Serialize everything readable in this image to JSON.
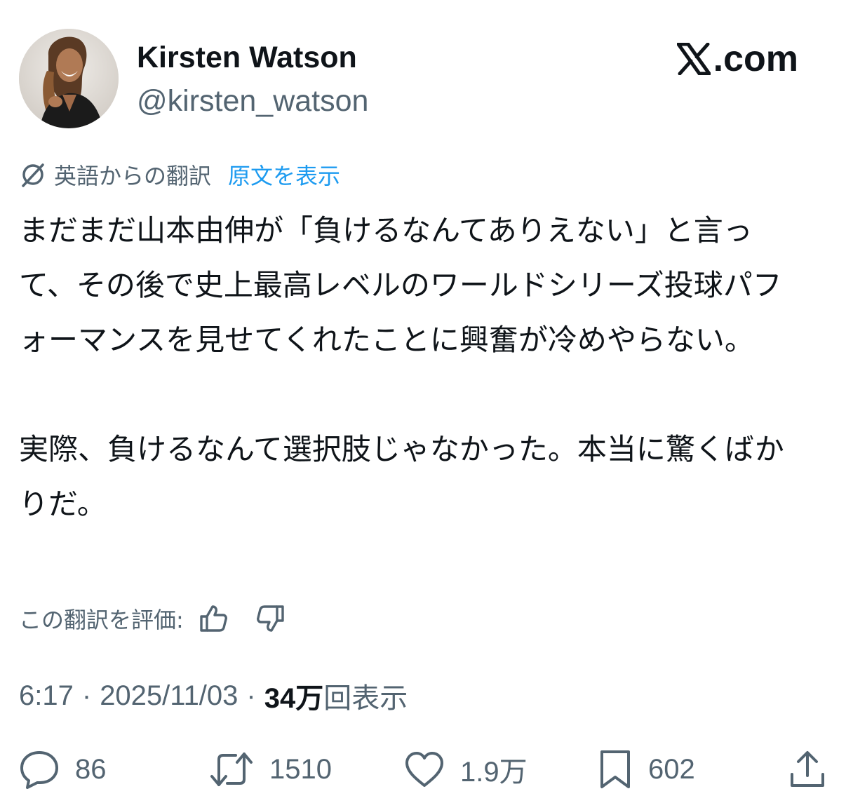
{
  "author": {
    "display_name": "Kirsten Watson",
    "handle": "@kirsten_watson"
  },
  "brand": {
    "label": ".com",
    "icon": "x-logo-icon"
  },
  "translation": {
    "icon": "translate-icon",
    "from_label": "英語からの翻訳",
    "show_original_label": "原文を表示"
  },
  "tweet": {
    "paragraphs": [
      "まだまだ山本由伸が「負けるなんてありえない」と言って、その後で史上最高レベルのワールドシリーズ投球パフォーマンスを見せてくれたことに興奮が冷めやらない。",
      "実際、負けるなんて選択肢じゃなかった。本当に驚くばかりだ。"
    ]
  },
  "rate_translation": {
    "label": "この翻訳を評価:",
    "up_icon": "thumbs-up-icon",
    "down_icon": "thumbs-down-icon"
  },
  "meta": {
    "time": "6:17",
    "separator": "·",
    "date": "2025/11/03",
    "views_count": "34万",
    "views_label": "回表示"
  },
  "actions": {
    "reply": {
      "icon": "reply-icon",
      "count": "86"
    },
    "repost": {
      "icon": "repost-icon",
      "count": "1510"
    },
    "like": {
      "icon": "heart-icon",
      "count": "1.9万"
    },
    "bookmark": {
      "icon": "bookmark-icon",
      "count": "602"
    },
    "share": {
      "icon": "share-icon"
    }
  },
  "colors": {
    "text_primary": "#0f1419",
    "text_secondary": "#536471",
    "link": "#1d9bf0",
    "background": "#ffffff"
  }
}
